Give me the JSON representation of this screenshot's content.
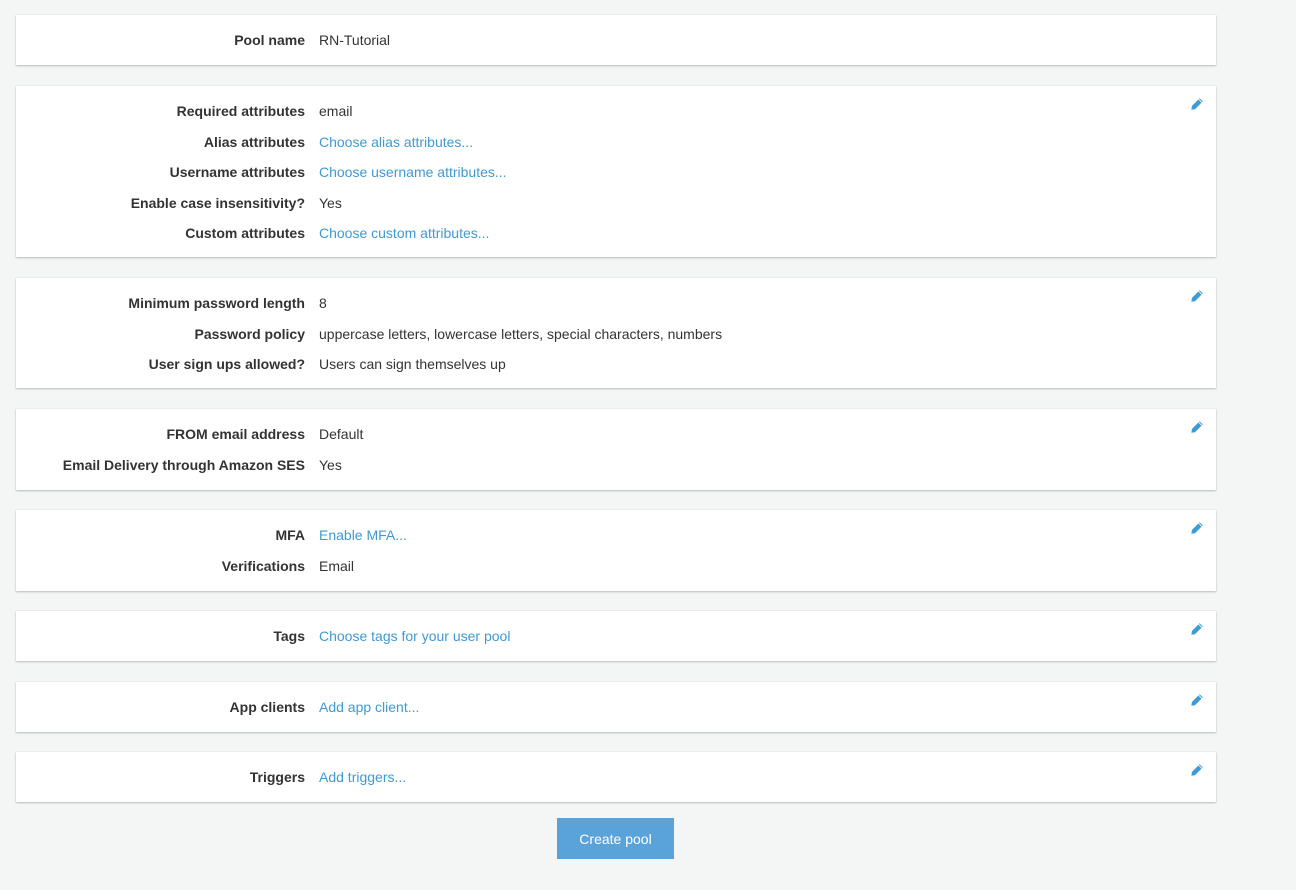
{
  "colors": {
    "background": "#f4f6f6",
    "panel": "#ffffff",
    "link": "#3e9ad4",
    "button": "#5aa3da"
  },
  "sections": {
    "pool": {
      "rows": [
        {
          "label": "Pool name",
          "value": "RN-Tutorial"
        }
      ]
    },
    "attributes": {
      "rows": [
        {
          "label": "Required attributes",
          "value": "email"
        },
        {
          "label": "Alias attributes",
          "value": "Choose alias attributes..."
        },
        {
          "label": "Username attributes",
          "value": "Choose username attributes..."
        },
        {
          "label": "Enable case insensitivity?",
          "value": "Yes"
        },
        {
          "label": "Custom attributes",
          "value": "Choose custom attributes..."
        }
      ]
    },
    "policies": {
      "rows": [
        {
          "label": "Minimum password length",
          "value": "8"
        },
        {
          "label": "Password policy",
          "value": "uppercase letters, lowercase letters, special characters, numbers"
        },
        {
          "label": "User sign ups allowed?",
          "value": "Users can sign themselves up"
        }
      ]
    },
    "email": {
      "rows": [
        {
          "label": "FROM email address",
          "value": "Default"
        },
        {
          "label": "Email Delivery through Amazon SES",
          "value": "Yes"
        }
      ]
    },
    "mfa": {
      "rows": [
        {
          "label": "MFA",
          "value": "Enable MFA..."
        },
        {
          "label": "Verifications",
          "value": "Email"
        }
      ]
    },
    "tags": {
      "rows": [
        {
          "label": "Tags",
          "value": "Choose tags for your user pool"
        }
      ]
    },
    "app_clients": {
      "rows": [
        {
          "label": "App clients",
          "value": "Add app client..."
        }
      ]
    },
    "triggers": {
      "rows": [
        {
          "label": "Triggers",
          "value": "Add triggers..."
        }
      ]
    }
  },
  "icons": {
    "edit": "pencil-icon"
  },
  "create_button": {
    "label": "Create pool"
  }
}
